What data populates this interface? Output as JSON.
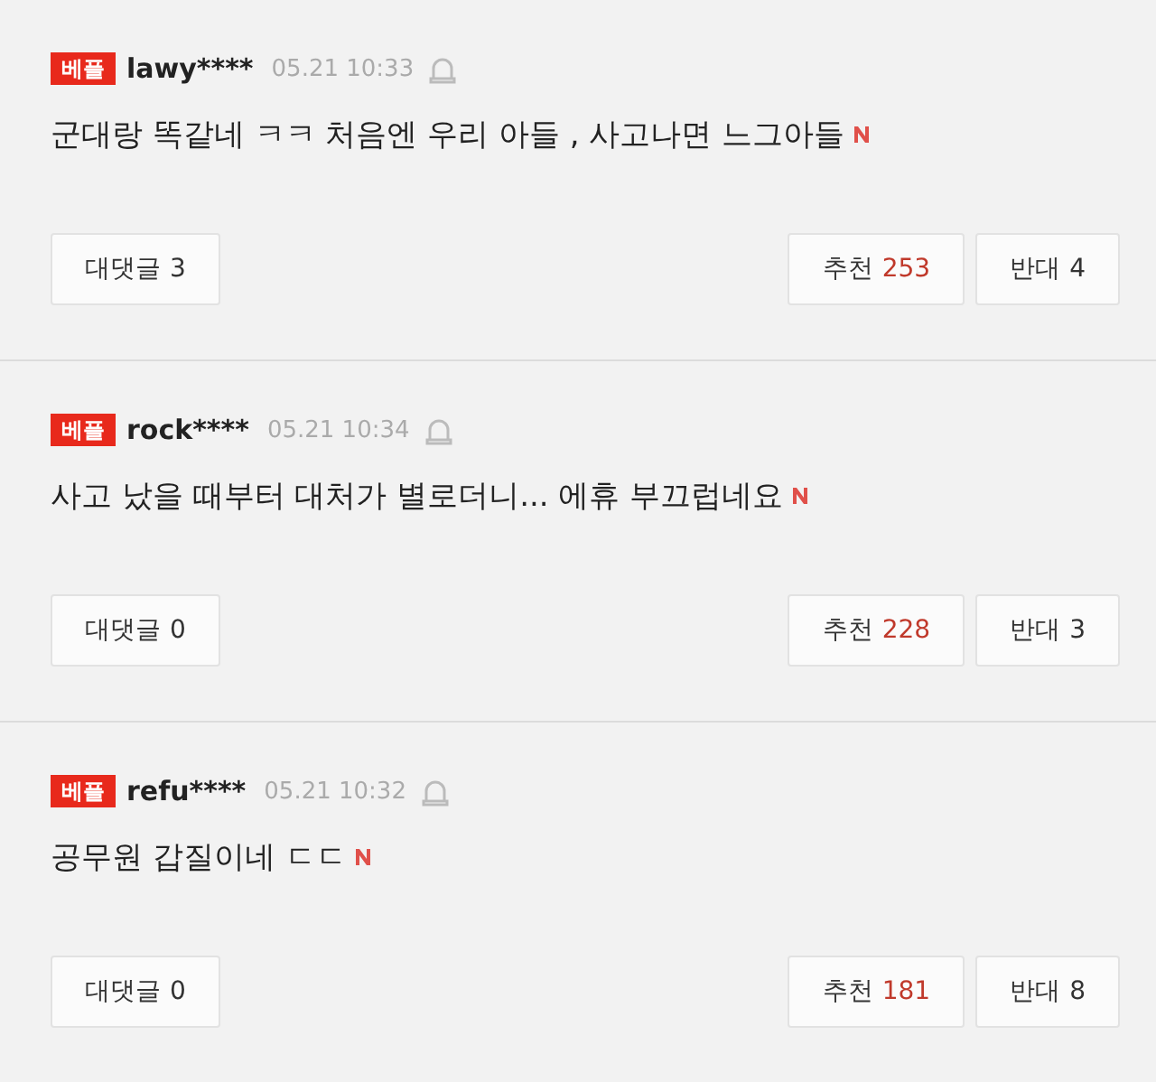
{
  "comments": [
    {
      "badge": "베플",
      "user": "lawy****",
      "time": "05.21 10:33",
      "text": "군대랑 똑같네 ㅋㅋ 처음엔 우리 아들 , 사고나면 느그아들",
      "new": true,
      "replies": {
        "label": "대댓글",
        "count": "3"
      },
      "like": {
        "label": "추천",
        "count": "253"
      },
      "dislike": {
        "label": "반대",
        "count": "4"
      }
    },
    {
      "badge": "베플",
      "user": "rock****",
      "time": "05.21 10:34",
      "text": "사고 났을 때부터 대처가 별로더니... 에휴 부끄럽네요",
      "new": true,
      "replies": {
        "label": "대댓글",
        "count": "0"
      },
      "like": {
        "label": "추천",
        "count": "228"
      },
      "dislike": {
        "label": "반대",
        "count": "3"
      }
    },
    {
      "badge": "베플",
      "user": "refu****",
      "time": "05.21 10:32",
      "text": "공무원 갑질이네 ㄷㄷ",
      "new": true,
      "replies": {
        "label": "대댓글",
        "count": "0"
      },
      "like": {
        "label": "추천",
        "count": "181"
      },
      "dislike": {
        "label": "반대",
        "count": "8"
      }
    }
  ]
}
